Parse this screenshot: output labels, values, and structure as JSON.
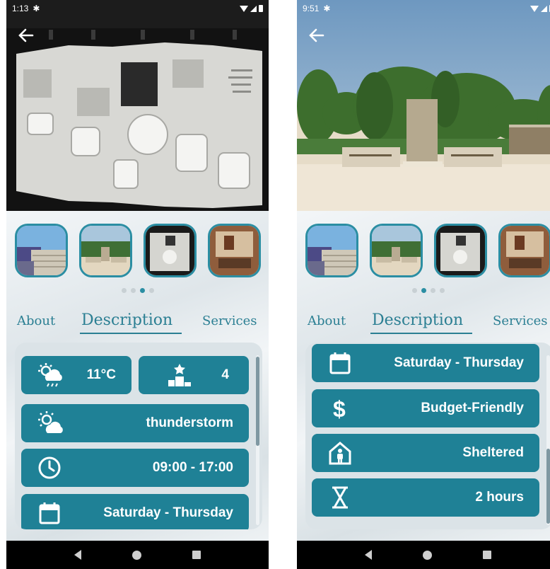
{
  "screens": [
    {
      "status_time": "1:13",
      "tabs": {
        "about": "About",
        "description": "Description",
        "services": "Services"
      },
      "page_indicator": {
        "count": 4,
        "active_index": 2
      },
      "cards": {
        "temperature": "11°C",
        "rating": "4",
        "weather": "thunderstorm",
        "hours": "09:00 - 17:00",
        "days": "Saturday - Thursday"
      },
      "icons": {
        "temperature": "weather-storm-icon",
        "rating": "podium-star-icon",
        "weather": "partly-cloudy-icon",
        "hours": "clock-icon",
        "days": "calendar-icon"
      }
    },
    {
      "status_time": "9:51",
      "tabs": {
        "about": "About",
        "description": "Description",
        "services": "Services"
      },
      "page_indicator": {
        "count": 4,
        "active_index": 1
      },
      "cards": {
        "days": "Saturday - Thursday",
        "budget": "Budget-Friendly",
        "shelter": "Sheltered",
        "duration": "2 hours"
      },
      "icons": {
        "days": "calendar-icon",
        "budget": "dollar-icon",
        "shelter": "shelter-icon",
        "duration": "hourglass-icon"
      }
    }
  ],
  "colors": {
    "accent": "#1f8196",
    "tab_text": "#2b7f93",
    "panel": "#dbe3e7"
  }
}
